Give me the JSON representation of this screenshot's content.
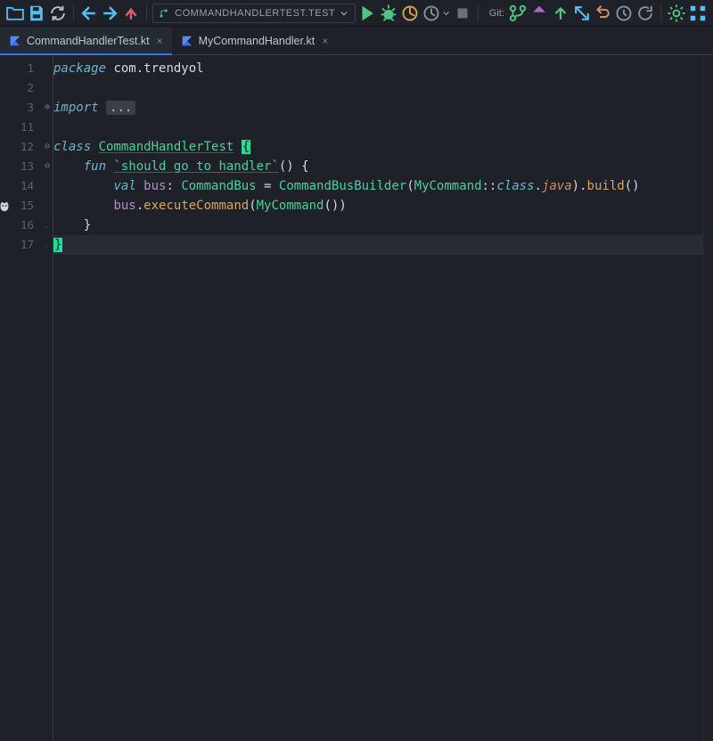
{
  "toolbar": {
    "git_label": "Git:"
  },
  "run_config": {
    "label": "COMMANDHANDLERTEST.TEST"
  },
  "tabs": [
    {
      "label": "CommandHandlerTest.kt",
      "active": true
    },
    {
      "label": "MyCommandHandler.kt",
      "active": false
    }
  ],
  "gutter_lines": [
    "1",
    "2",
    "3",
    "11",
    "12",
    "13",
    "14",
    "15",
    "16",
    "17"
  ],
  "code": {
    "l1_kw": "package",
    "l1_rest": " com.trendyol",
    "l3_kw": "import",
    "l3_fold": "...",
    "l12_kw": "class ",
    "l12_name": "CommandHandlerTest",
    "l12_brace": "{",
    "l13_kw": "fun ",
    "l13_name": "`should go to handler`",
    "l13_rest": "() {",
    "l14_kw": "val ",
    "l14_var": "bus",
    "l14_colon": ": ",
    "l14_t1": "CommandBus",
    "l14_eq": " = ",
    "l14_t2": "CommandBusBuilder",
    "l14_p1": "(",
    "l14_t3": "MyCommand",
    "l14_dcol": "::",
    "l14_cls": "class",
    "l14_dot1": ".",
    "l14_java": "java",
    "l14_p2": ").",
    "l14_build": "build",
    "l14_p3": "()",
    "l15_recv": "bus",
    "l15_dot": ".",
    "l15_call": "executeCommand",
    "l15_p1": "(",
    "l15_t": "MyCommand",
    "l15_p2": "())",
    "l16_brace": "}",
    "l17_brace": "}"
  }
}
